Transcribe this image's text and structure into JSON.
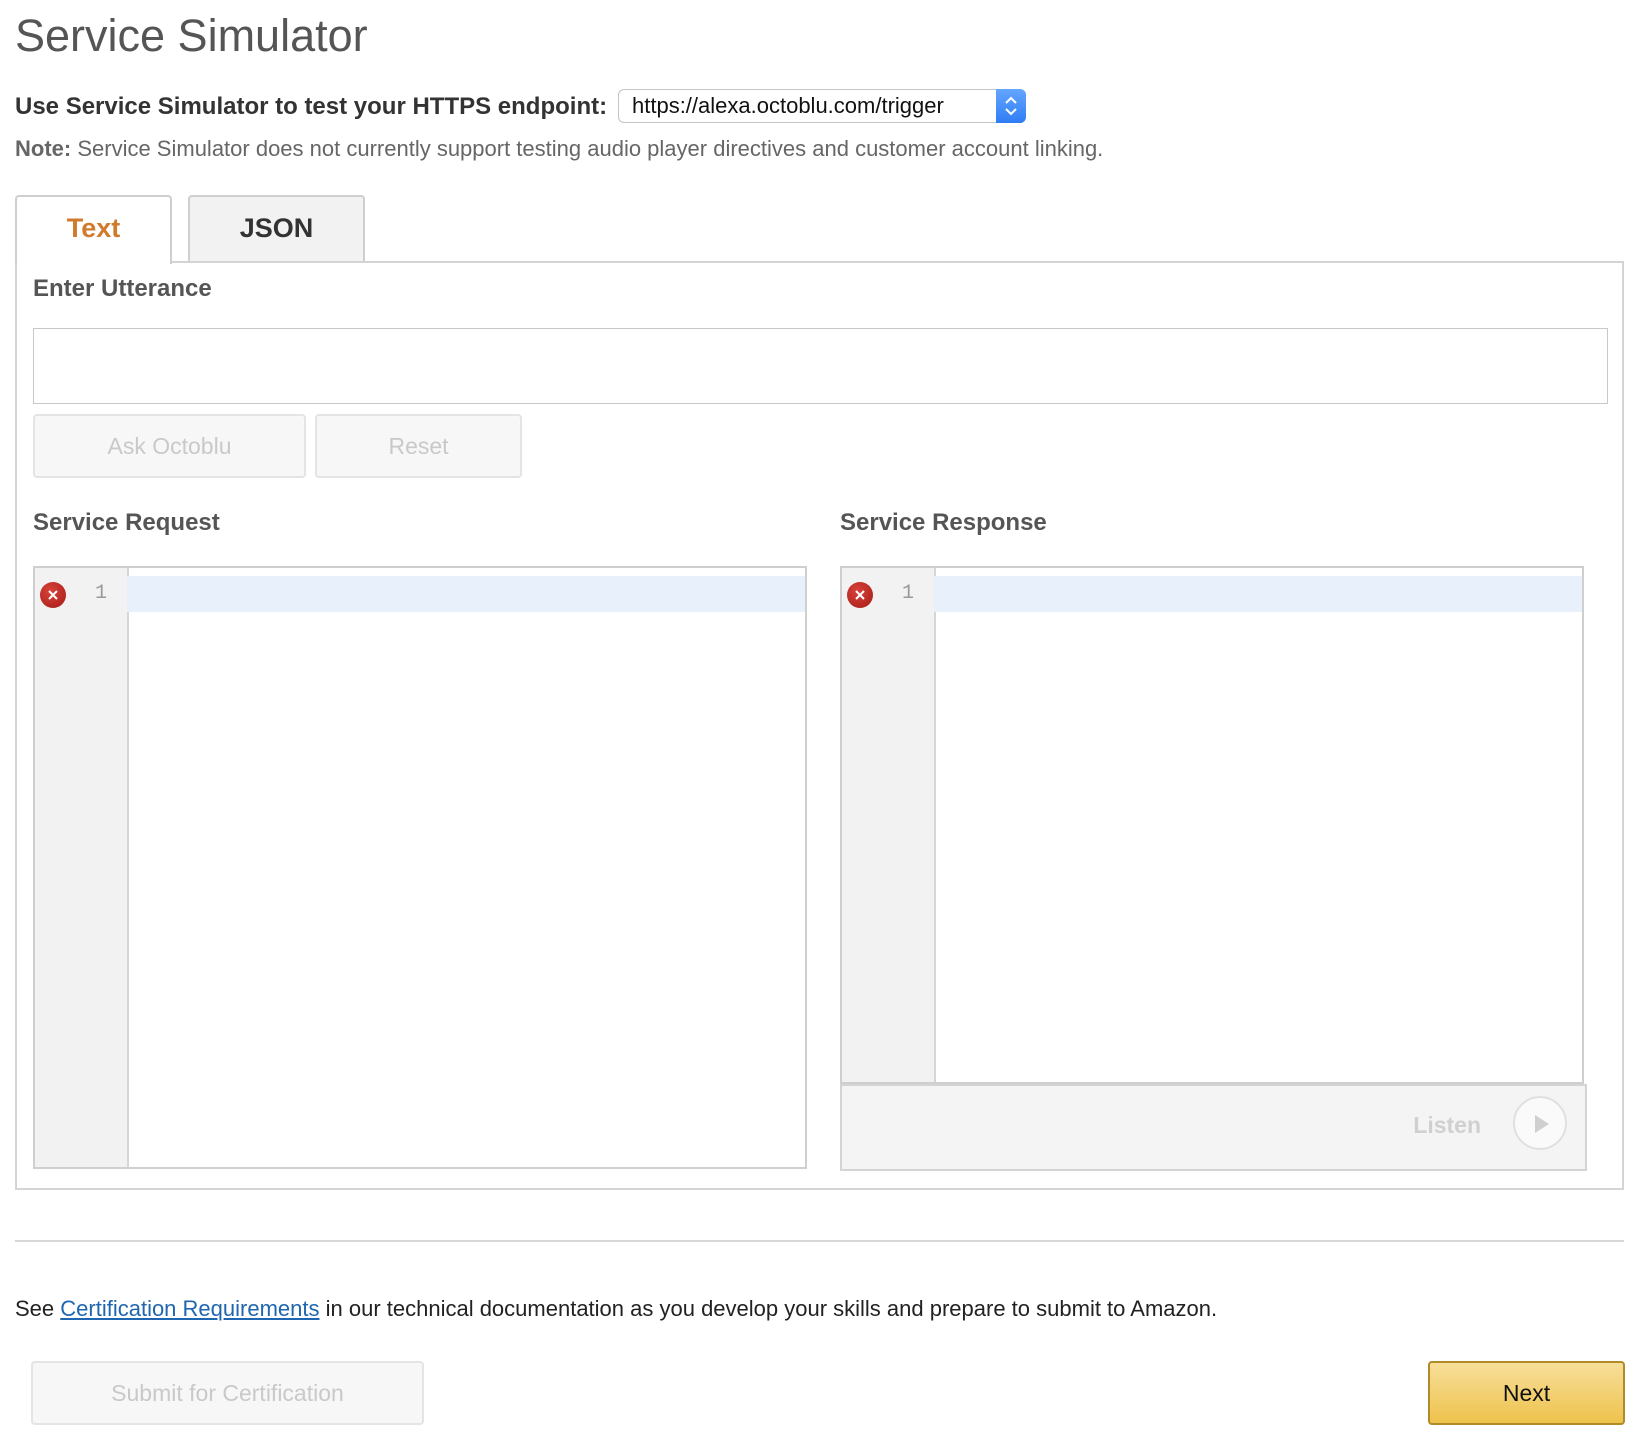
{
  "page": {
    "title": "Service Simulator"
  },
  "endpoint": {
    "label": "Use Service Simulator to test your HTTPS endpoint:",
    "selected": "https://alexa.octoblu.com/trigger"
  },
  "note": {
    "prefix": "Note:",
    "text": " Service Simulator does not currently support testing audio player directives and customer account linking."
  },
  "tabs": [
    {
      "label": "Text",
      "active": true
    },
    {
      "label": "JSON",
      "active": false
    }
  ],
  "utterance": {
    "label": "Enter Utterance",
    "value": "",
    "ask_button": "Ask Octoblu",
    "reset_button": "Reset"
  },
  "request": {
    "label": "Service Request",
    "line_number": "1"
  },
  "response": {
    "label": "Service Response",
    "line_number": "1",
    "listen_label": "Listen"
  },
  "footer": {
    "see": "See ",
    "link": "Certification Requirements",
    "rest": " in our technical documentation as you develop your skills and prepare to submit to Amazon.",
    "submit_button": "Submit for Certification",
    "next_button": "Next"
  },
  "colors": {
    "active_tab": "#d07a2c",
    "link": "#1f66b0",
    "next_button": "#eec24c",
    "error_icon": "#b3221c"
  },
  "icons": [
    "select-arrows-icon",
    "error-icon",
    "play-icon"
  ]
}
